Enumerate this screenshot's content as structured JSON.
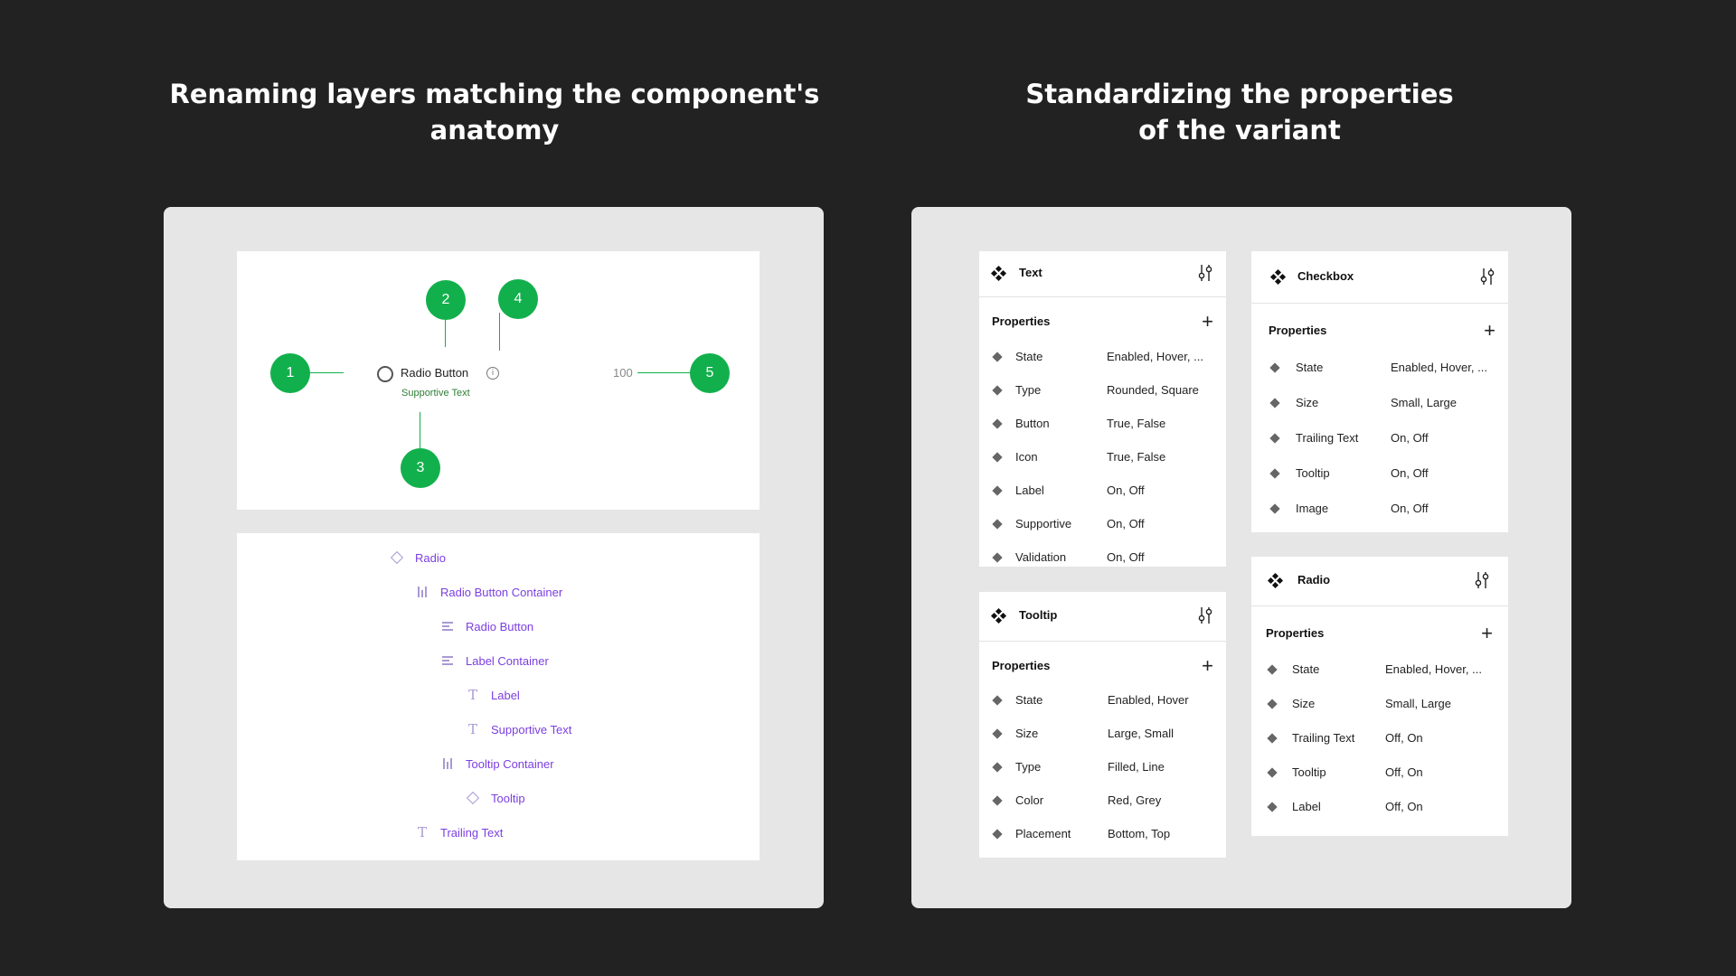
{
  "headings": {
    "left": [
      "Renaming layers matching the component's",
      "anatomy"
    ],
    "right": [
      "Standardizing the properties",
      "of the variant"
    ]
  },
  "anatomy": {
    "markers": [
      "1",
      "2",
      "3",
      "4",
      "5"
    ],
    "radio_label": "Radio Button",
    "supportive_text": "Supportive Text",
    "info_glyph": "i",
    "trailing_text": "100"
  },
  "layers": [
    {
      "label": "Radio",
      "icon": "component-outline-icon"
    },
    {
      "label": "Radio Button Container",
      "icon": "auto-layout-horizontal-icon"
    },
    {
      "label": "Radio Button",
      "icon": "auto-layout-vertical-icon"
    },
    {
      "label": "Label Container",
      "icon": "auto-layout-vertical-icon"
    },
    {
      "label": "Label",
      "icon": "text-icon"
    },
    {
      "label": "Supportive Text",
      "icon": "text-icon"
    },
    {
      "label": "Tooltip Container",
      "icon": "auto-layout-horizontal-icon"
    },
    {
      "label": "Tooltip",
      "icon": "component-outline-icon"
    },
    {
      "label": "Trailing Text",
      "icon": "text-icon"
    }
  ],
  "property_cards": {
    "properties_label": "Properties",
    "plus": "+",
    "text": {
      "title": "Text",
      "rows": [
        {
          "name": "State",
          "value": "Enabled, Hover, ..."
        },
        {
          "name": "Type",
          "value": "Rounded, Square"
        },
        {
          "name": "Button",
          "value": "True, False"
        },
        {
          "name": "Icon",
          "value": "True, False"
        },
        {
          "name": "Label",
          "value": "On, Off"
        },
        {
          "name": "Supportive",
          "value": "On, Off"
        },
        {
          "name": "Validation",
          "value": "On, Off"
        }
      ]
    },
    "tooltip": {
      "title": "Tooltip",
      "rows": [
        {
          "name": "State",
          "value": "Enabled, Hover"
        },
        {
          "name": "Size",
          "value": "Large, Small"
        },
        {
          "name": "Type",
          "value": "Filled, Line"
        },
        {
          "name": "Color",
          "value": "Red, Grey"
        },
        {
          "name": "Placement",
          "value": "Bottom, Top"
        }
      ]
    },
    "checkbox": {
      "title": "Checkbox",
      "rows": [
        {
          "name": "State",
          "value": "Enabled, Hover, ..."
        },
        {
          "name": "Size",
          "value": "Small, Large"
        },
        {
          "name": "Trailing Text",
          "value": "On, Off"
        },
        {
          "name": "Tooltip",
          "value": "On, Off"
        },
        {
          "name": "Image",
          "value": "On, Off"
        }
      ]
    },
    "radio": {
      "title": "Radio",
      "rows": [
        {
          "name": "State",
          "value": "Enabled, Hover, ..."
        },
        {
          "name": "Size",
          "value": "Small, Large"
        },
        {
          "name": "Trailing Text",
          "value": "Off, On"
        },
        {
          "name": "Tooltip",
          "value": "Off, On"
        },
        {
          "name": "Label",
          "value": "Off, On"
        }
      ]
    }
  },
  "colors": {
    "background": "#222222",
    "panel": "#e6e6e6",
    "marker_green": "#12b04c",
    "layer_purple": "#7b3fe0"
  }
}
